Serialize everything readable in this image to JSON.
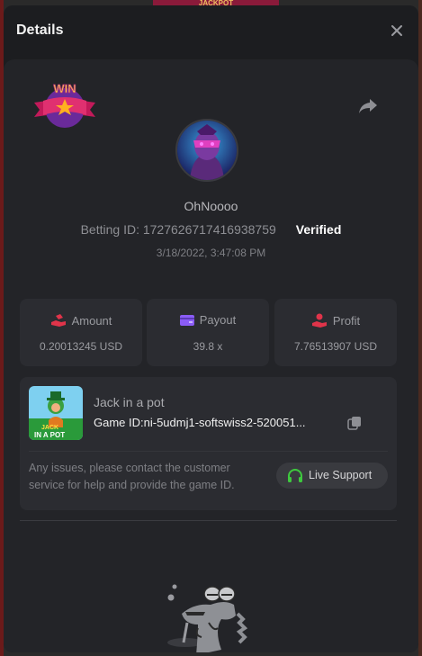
{
  "background": {
    "banner_text": "JACKPOT"
  },
  "modal": {
    "title": "Details"
  },
  "player": {
    "username": "OhNoooo",
    "betting_id": "Betting ID: 1727626717416938759",
    "verified": "Verified",
    "date": "3/18/2022, 3:47:08 PM",
    "badge_text": "WIN"
  },
  "stats": {
    "amount": {
      "label": "Amount",
      "value": "0.20013245 USD",
      "icon": "hand-coins-icon"
    },
    "payout": {
      "label": "Payout",
      "value": "39.8 x",
      "icon": "wallet-icon"
    },
    "profit": {
      "label": "Profit",
      "value": "7.76513907 USD",
      "icon": "profit-hand-icon"
    }
  },
  "game": {
    "name": "Jack in a pot",
    "id_label": "Game ID:",
    "id_value": "ni-5udmj1-softswiss2-520051...",
    "thumb_text_1": "JACK",
    "thumb_text_2": "IN A POT"
  },
  "support": {
    "help_text": "Any issues, please contact the customer service for help and provide the game ID.",
    "button_label": "Live Support"
  },
  "colors": {
    "modal_bg": "#1c1d20",
    "panel_bg": "#232428",
    "card_bg": "#2b2c31",
    "accent_green": "#3ec93e",
    "accent_red": "#e0344a",
    "accent_purple": "#8b5cf6"
  }
}
